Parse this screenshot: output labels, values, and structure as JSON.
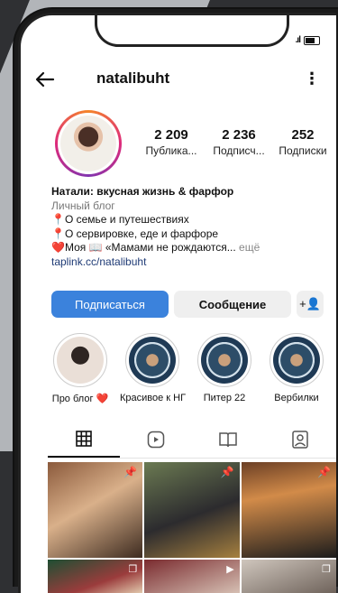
{
  "status": {
    "signal": ".ıl"
  },
  "profile": {
    "username": "natalibuht",
    "stats": [
      {
        "value": "2 209",
        "label": "Публика..."
      },
      {
        "value": "2 236",
        "label": "Подписч..."
      },
      {
        "value": "252",
        "label": "Подписки"
      }
    ],
    "bio": {
      "name": "Натали: вкусная жизнь & фарфор",
      "category": "Личный блог",
      "line1": "📍О семье и путешествиях",
      "line2": "📍О сервировке, еде и фарфоре",
      "line3": "❤️Моя 📖 «Мамами не рождаются...",
      "more": " ещё",
      "link": "taplink.cc/natalibuht"
    }
  },
  "actions": {
    "follow": "Подписаться",
    "message": "Сообщение",
    "add": "+👤"
  },
  "highlights": [
    {
      "label": "Про блог ❤️"
    },
    {
      "label": "Красивое к НГ"
    },
    {
      "label": "Питер 22"
    },
    {
      "label": "Вербилки"
    }
  ],
  "tabs": [
    "grid-icon",
    "reels-icon",
    "guide-icon",
    "tagged-icon"
  ],
  "colors": {
    "accent": "#3b82dc",
    "link": "#1e3a75"
  }
}
